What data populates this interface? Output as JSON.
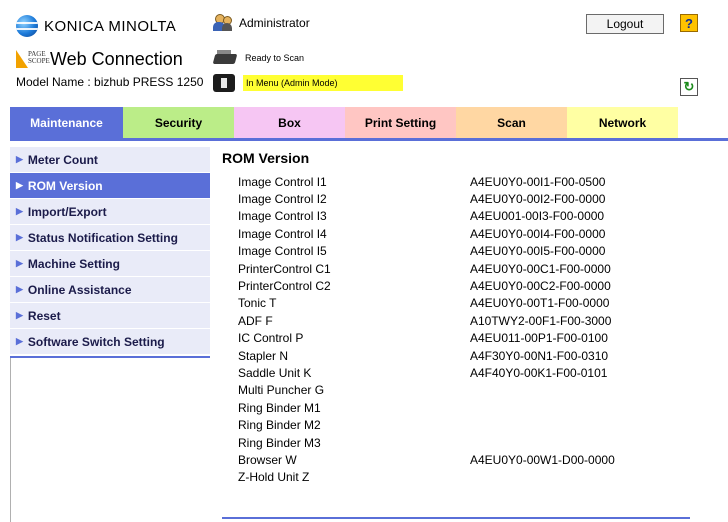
{
  "header": {
    "brand": "KONICA MINOLTA",
    "pagescope_logo_text": "PAGE SCOPE",
    "web_connection": "Web Connection",
    "model_name": "Model Name : bizhub PRESS 1250",
    "user": "Administrator",
    "logout_label": "Logout",
    "help_label": "?",
    "status_ready": "Ready to Scan",
    "status_menu": "In Menu (Admin Mode)",
    "refresh_icon": "refresh-icon"
  },
  "tabs": [
    {
      "label": "Maintenance",
      "color": "#5a6fd8",
      "active": true
    },
    {
      "label": "Security",
      "color": "#bbed88"
    },
    {
      "label": "Box",
      "color": "#f6c6f3"
    },
    {
      "label": "Print Setting",
      "color": "#ffc6c3"
    },
    {
      "label": "Scan",
      "color": "#ffd7a3"
    },
    {
      "label": "Network",
      "color": "#ffffa3"
    }
  ],
  "sidebar": {
    "items": [
      {
        "label": "Meter Count"
      },
      {
        "label": "ROM Version",
        "active": true
      },
      {
        "label": "Import/Export"
      },
      {
        "label": "Status Notification Setting"
      },
      {
        "label": "Machine Setting"
      },
      {
        "label": "Online Assistance"
      },
      {
        "label": "Reset"
      },
      {
        "label": "Software Switch Setting"
      }
    ]
  },
  "content": {
    "title": "ROM Version",
    "rows": [
      {
        "name": "Image Control I1",
        "version": "A4EU0Y0-00I1-F00-0500"
      },
      {
        "name": "Image Control I2",
        "version": "A4EU0Y0-00I2-F00-0000"
      },
      {
        "name": "Image Control I3",
        "version": "A4EU001-00I3-F00-0000"
      },
      {
        "name": "Image Control I4",
        "version": "A4EU0Y0-00I4-F00-0000"
      },
      {
        "name": "Image Control I5",
        "version": "A4EU0Y0-00I5-F00-0000"
      },
      {
        "name": "PrinterControl C1",
        "version": "A4EU0Y0-00C1-F00-0000"
      },
      {
        "name": "PrinterControl C2",
        "version": "A4EU0Y0-00C2-F00-0000"
      },
      {
        "name": "Tonic T",
        "version": "A4EU0Y0-00T1-F00-0000"
      },
      {
        "name": "ADF F",
        "version": "A10TWY2-00F1-F00-3000"
      },
      {
        "name": "IC Control P",
        "version": "A4EU011-00P1-F00-0100"
      },
      {
        "name": "Stapler N",
        "version": "A4F30Y0-00N1-F00-0310"
      },
      {
        "name": "Saddle Unit K",
        "version": "A4F40Y0-00K1-F00-0101"
      },
      {
        "name": "Multi Puncher G",
        "version": ""
      },
      {
        "name": "Ring Binder M1",
        "version": ""
      },
      {
        "name": "Ring Binder M2",
        "version": ""
      },
      {
        "name": "Ring Binder M3",
        "version": ""
      },
      {
        "name": "Browser W",
        "version": "A4EU0Y0-00W1-D00-0000"
      },
      {
        "name": "Z-Hold Unit Z",
        "version": ""
      }
    ]
  }
}
